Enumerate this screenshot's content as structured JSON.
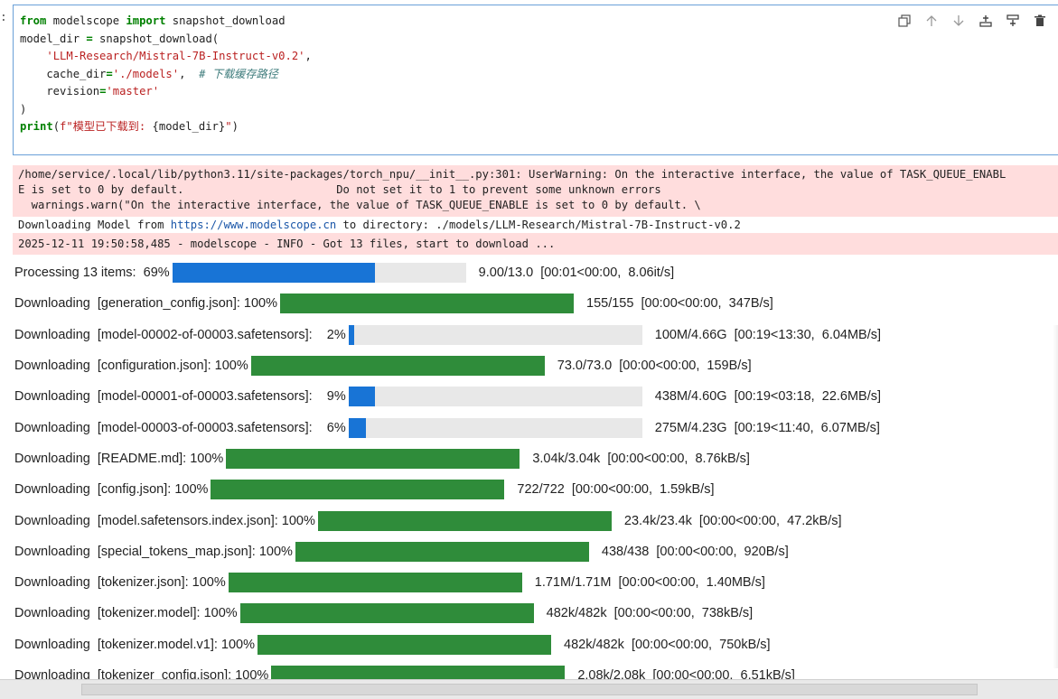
{
  "prompt_marker": ":",
  "code_lines": [
    [
      {
        "t": "from",
        "c": "kw"
      },
      {
        "t": " modelscope ",
        "c": ""
      },
      {
        "t": "import",
        "c": "kw"
      },
      {
        "t": " snapshot_download",
        "c": ""
      }
    ],
    [
      {
        "t": "model_dir ",
        "c": ""
      },
      {
        "t": "=",
        "c": "kw"
      },
      {
        "t": " snapshot_download(",
        "c": ""
      }
    ],
    [
      {
        "t": "    ",
        "c": ""
      },
      {
        "t": "'LLM-Research/Mistral-7B-Instruct-v0.2'",
        "c": "str"
      },
      {
        "t": ",",
        "c": ""
      }
    ],
    [
      {
        "t": "    cache_dir",
        "c": ""
      },
      {
        "t": "=",
        "c": "kw"
      },
      {
        "t": "'./models'",
        "c": "str"
      },
      {
        "t": ",  ",
        "c": ""
      },
      {
        "t": "# 下载缓存路径",
        "c": "cmt"
      }
    ],
    [
      {
        "t": "    revision",
        "c": ""
      },
      {
        "t": "=",
        "c": "kw"
      },
      {
        "t": "'master'",
        "c": "str"
      }
    ],
    [
      {
        "t": ")",
        "c": ""
      }
    ],
    [
      {
        "t": "print",
        "c": "kw"
      },
      {
        "t": "(",
        "c": ""
      },
      {
        "t": "f\"模型已下载到: ",
        "c": "str"
      },
      {
        "t": "{model_dir}",
        "c": ""
      },
      {
        "t": "\"",
        "c": "str"
      },
      {
        "t": ")",
        "c": ""
      }
    ]
  ],
  "toolbar": [
    "copy-icon",
    "move-up-icon",
    "move-down-icon",
    "insert-above-icon",
    "insert-below-icon",
    "delete-icon"
  ],
  "warning_lines": [
    "/home/service/.local/lib/python3.11/site-packages/torch_npu/__init__.py:301: UserWarning: On the interactive interface, the value of TASK_QUEUE_ENABL",
    "E is set to 0 by default.                       Do not set it to 1 to prevent some unknown errors",
    "  warnings.warn(\"On the interactive interface, the value of TASK_QUEUE_ENABLE is set to 0 by default. \\"
  ],
  "download_line": {
    "prefix": "Downloading Model from ",
    "url": "https://www.modelscope.cn",
    "suffix": " to directory: ./models/LLM-Research/Mistral-7B-Instruct-v0.2"
  },
  "info_line": "2025-12-11 19:50:58,485 - modelscope - INFO - Got 13 files, start to download ...",
  "progress_rows": [
    {
      "label": "Processing 13 items:  69%",
      "progress": 0.69,
      "color": "blue",
      "status": "9.00/13.0  [00:01<00:00,  8.06it/s]"
    },
    {
      "label": "Downloading  [generation_config.json]: 100%",
      "progress": 1.0,
      "color": "green",
      "status": "155/155  [00:00<00:00,  347B/s]"
    },
    {
      "label": "Downloading  [model-00002-of-00003.safetensors]:    2%",
      "progress": 0.02,
      "color": "blue",
      "status": "100M/4.66G  [00:19<13:30,  6.04MB/s]"
    },
    {
      "label": "Downloading  [configuration.json]: 100%",
      "progress": 1.0,
      "color": "green",
      "status": "73.0/73.0  [00:00<00:00,  159B/s]"
    },
    {
      "label": "Downloading  [model-00001-of-00003.safetensors]:    9%",
      "progress": 0.09,
      "color": "blue",
      "status": "438M/4.60G  [00:19<03:18,  22.6MB/s]"
    },
    {
      "label": "Downloading  [model-00003-of-00003.safetensors]:    6%",
      "progress": 0.06,
      "color": "blue",
      "status": "275M/4.23G  [00:19<11:40,  6.07MB/s]"
    },
    {
      "label": "Downloading  [README.md]: 100%",
      "progress": 1.0,
      "color": "green",
      "status": "3.04k/3.04k  [00:00<00:00,  8.76kB/s]"
    },
    {
      "label": "Downloading  [config.json]: 100%",
      "progress": 1.0,
      "color": "green",
      "status": "722/722  [00:00<00:00,  1.59kB/s]"
    },
    {
      "label": "Downloading  [model.safetensors.index.json]: 100%",
      "progress": 1.0,
      "color": "green",
      "status": "23.4k/23.4k  [00:00<00:00,  47.2kB/s]"
    },
    {
      "label": "Downloading  [special_tokens_map.json]: 100%",
      "progress": 1.0,
      "color": "green",
      "status": "438/438  [00:00<00:00,  920B/s]"
    },
    {
      "label": "Downloading  [tokenizer.json]: 100%",
      "progress": 1.0,
      "color": "green",
      "status": "1.71M/1.71M  [00:00<00:00,  1.40MB/s]"
    },
    {
      "label": "Downloading  [tokenizer.model]: 100%",
      "progress": 1.0,
      "color": "green",
      "status": "482k/482k  [00:00<00:00,  738kB/s]"
    },
    {
      "label": "Downloading  [tokenizer.model.v1]: 100%",
      "progress": 1.0,
      "color": "green",
      "status": "482k/482k  [00:00<00:00,  750kB/s]"
    },
    {
      "label": "Downloading  [tokenizer_config.json]: 100%",
      "progress": 1.0,
      "color": "green",
      "status": "2.08k/2.08k  [00:00<00:00,  6.51kB/s]"
    }
  ],
  "colors": {
    "green": "#2f8c3a",
    "blue": "#1874d6",
    "warning_bg": "#ffdddd",
    "cell_border": "#6aa0d8"
  }
}
